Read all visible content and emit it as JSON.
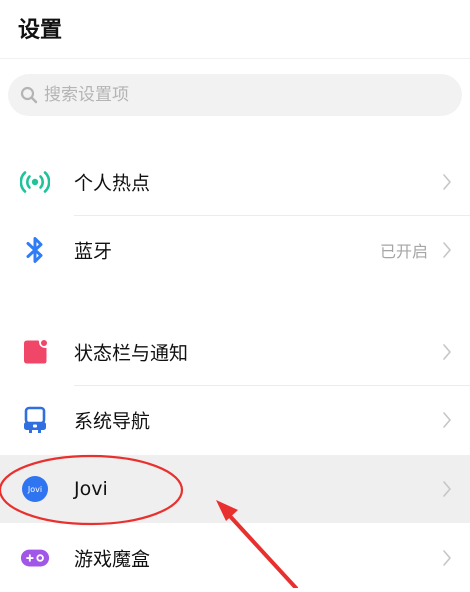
{
  "header": {
    "title": "设置"
  },
  "search": {
    "placeholder": "搜索设置项"
  },
  "settings": {
    "hotspot": {
      "label": "个人热点"
    },
    "bluetooth": {
      "label": "蓝牙",
      "status": "已开启"
    },
    "status_bar": {
      "label": "状态栏与通知"
    },
    "navigation": {
      "label": "系统导航"
    },
    "jovi": {
      "label": "Jovi",
      "icon_text": "Jovi"
    },
    "game_box": {
      "label": "游戏魔盒"
    }
  },
  "icons": {
    "hotspot": "hotspot-icon",
    "bluetooth": "bluetooth-icon",
    "status_bar": "notification-icon",
    "navigation": "navigation-icon",
    "jovi": "jovi-icon",
    "game_box": "gamepad-icon",
    "search": "search-icon",
    "chevron": "chevron-right-icon"
  },
  "colors": {
    "hotspot_green": "#1fc39a",
    "bluetooth_blue": "#2f7df6",
    "notification_red": "#f04668",
    "navigation_blue": "#2f6fe0",
    "jovi_blue": "#2f74f0",
    "game_purple": "#a056e6",
    "annotation_red": "#e8302e"
  }
}
